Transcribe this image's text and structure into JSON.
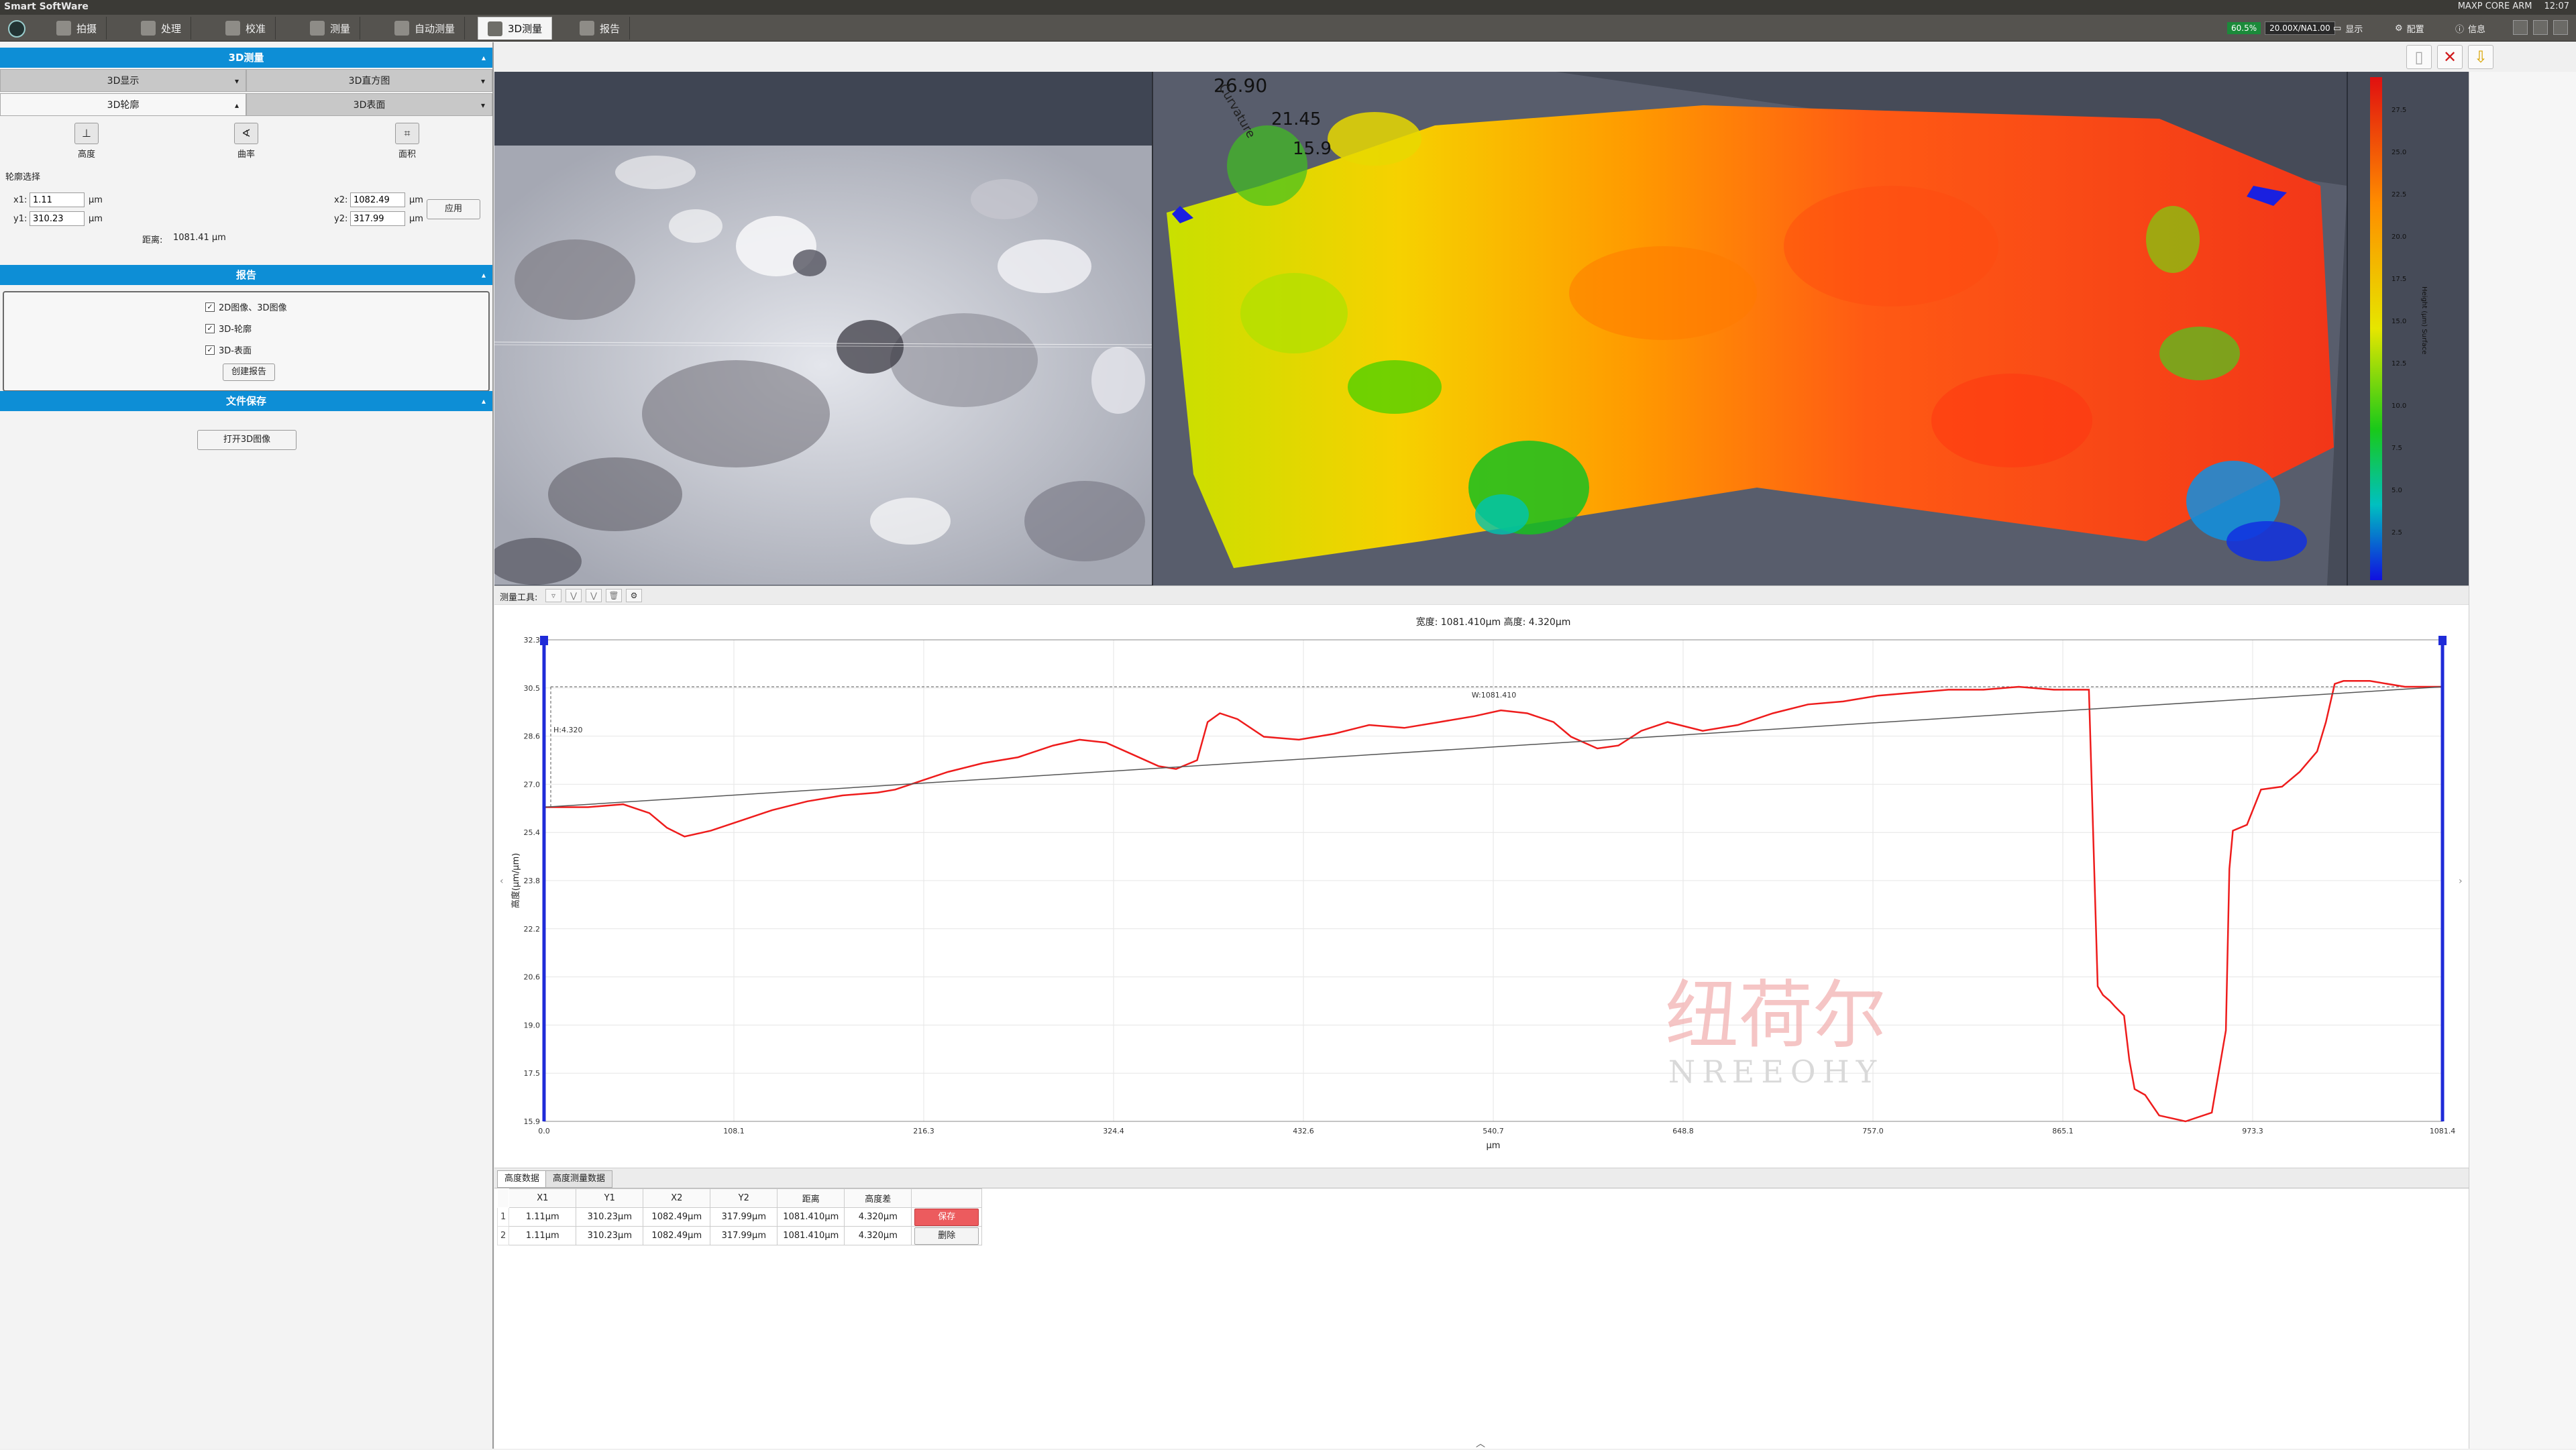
{
  "os_bar": {
    "title": "Smart SoftWare",
    "tray": [
      "MAXP CORE ARM",
      "12:07"
    ]
  },
  "nav_tabs": [
    {
      "label": "拍摄",
      "icon": "camera-icon"
    },
    {
      "label": "处理",
      "icon": "process-icon"
    },
    {
      "label": "校准",
      "icon": "ruler-icon"
    },
    {
      "label": "测量",
      "icon": "measure-icon"
    },
    {
      "label": "自动测量",
      "icon": "auto-measure-icon"
    },
    {
      "label": "3D测量",
      "icon": "cube-icon",
      "active": true
    },
    {
      "label": "报告",
      "icon": "report-icon"
    }
  ],
  "toolbar_right": {
    "status": "60.5%",
    "zoom": "20.00X/NA1.00",
    "display_label": "显示",
    "config_label": "配置",
    "info_label": "信息"
  },
  "left_panel": {
    "measure3d_title": "3D测量",
    "sub_tabs": [
      "3D显示",
      "3D直方图",
      "3D轮廓",
      "3D表面"
    ],
    "tools": [
      {
        "label": "高度",
        "icon": "height-icon",
        "glyph": "⊥"
      },
      {
        "label": "曲率",
        "icon": "curvature-icon",
        "glyph": "∢"
      },
      {
        "label": "面积",
        "icon": "area-icon",
        "glyph": "⌗"
      }
    ],
    "profile_select_label": "轮廓选择",
    "x1_label": "x1:",
    "x1_value": "1.11",
    "y1_label": "y1:",
    "y1_value": "310.23",
    "x2_label": "x2:",
    "x2_value": "1082.49",
    "y2_label": "y2:",
    "y2_value": "317.99",
    "unit": "μm",
    "apply_button": "应用",
    "distance_label": "距离:",
    "distance_value": "1081.41  μm",
    "report_title": "报告",
    "report_options": [
      "2D图像、3D图像",
      "3D-轮廓",
      "3D-表面"
    ],
    "create_report_button": "创建报告",
    "file_save_title": "文件保存",
    "open_3d_button": "打开3D图像"
  },
  "viewer3d": {
    "axis_values": [
      "26.90",
      "21.45",
      "15.9"
    ],
    "axis_name": "Curvature",
    "colorbar_ticks": [
      "27.5",
      "25.0",
      "22.5",
      "20.0",
      "17.5",
      "15.0",
      "12.5",
      "10.0",
      "7.5",
      "5.0",
      "2.5"
    ],
    "colorbar_label": "Height (μm) Surface"
  },
  "meas_toolbar_label": "测量工具:",
  "chart_data": {
    "type": "line",
    "title": "宽度: 1081.410μm 高度: 4.320μm",
    "xlabel": "μm",
    "ylabel": "高度(μm/μm)",
    "xlim": [
      0.0,
      1081.4
    ],
    "ylim": [
      15.9,
      32.3
    ],
    "x_ticks": [
      "0.0",
      "108.1",
      "216.3",
      "324.4",
      "432.6",
      "540.7",
      "648.8",
      "757.0",
      "865.1",
      "973.3",
      "1081.4"
    ],
    "y_ticks": [
      "32.3",
      "30.5",
      "28.6",
      "27.0",
      "25.4",
      "23.8",
      "22.2",
      "20.6",
      "19.0",
      "17.5",
      "15.9"
    ],
    "annotation_width": "W:1081.410",
    "annotation_height": "H:4.320",
    "grid": true,
    "watermark_cn": "纽荷尔",
    "watermark_en": "NREEOHY",
    "series": [
      {
        "color": "#ee1c1c",
        "x": [
          0,
          25,
          45,
          60,
          70,
          80,
          95,
          110,
          130,
          150,
          170,
          190,
          200,
          215,
          230,
          250,
          270,
          290,
          305,
          320,
          335,
          350,
          360,
          372,
          378,
          385,
          395,
          410,
          430,
          450,
          470,
          490,
          510,
          530,
          545,
          560,
          575,
          585,
          600,
          612,
          625,
          640,
          660,
          680,
          700,
          720,
          740,
          760,
          780,
          800,
          820,
          840,
          860,
          870,
          880,
          885,
          888,
          892,
          895,
          900,
          903,
          906,
          912,
          920,
          935,
          950,
          958,
          960,
          962,
          970,
          978,
          990,
          1000,
          1010,
          1015,
          1020,
          1025,
          1040,
          1060,
          1081.4
        ],
        "y": [
          26.6,
          26.6,
          26.7,
          26.4,
          25.9,
          25.6,
          25.8,
          26.1,
          26.5,
          26.8,
          27.0,
          27.1,
          27.2,
          27.5,
          27.8,
          28.1,
          28.3,
          28.7,
          28.9,
          28.8,
          28.4,
          28.0,
          27.9,
          28.2,
          29.5,
          29.8,
          29.6,
          29.0,
          28.9,
          29.1,
          29.4,
          29.3,
          29.5,
          29.7,
          29.9,
          29.8,
          29.5,
          29.0,
          28.6,
          28.7,
          29.2,
          29.5,
          29.2,
          29.4,
          29.8,
          30.1,
          30.2,
          30.4,
          30.5,
          30.6,
          30.6,
          30.7,
          30.6,
          30.6,
          30.6,
          20.5,
          20.2,
          20.0,
          19.8,
          19.5,
          18.0,
          17.0,
          16.8,
          16.1,
          15.9,
          16.2,
          19.0,
          24.5,
          25.8,
          26.0,
          27.2,
          27.3,
          27.8,
          28.5,
          29.5,
          30.8,
          30.9,
          30.9,
          30.7,
          30.7
        ]
      },
      {
        "color": "#555555",
        "x": [
          0,
          1081.4
        ],
        "y": [
          26.6,
          30.7
        ]
      }
    ]
  },
  "table": {
    "tabs": [
      "高度数据",
      "高度测量数据"
    ],
    "headers": [
      "X1",
      "Y1",
      "X2",
      "Y2",
      "距离",
      "高度差"
    ],
    "rows": [
      {
        "num": "1",
        "cells": [
          "1.11μm",
          "310.23μm",
          "1082.49μm",
          "317.99μm",
          "1081.410μm",
          "4.320μm"
        ],
        "action": "保存"
      },
      {
        "num": "2",
        "cells": [
          "1.11μm",
          "310.23μm",
          "1082.49μm",
          "317.99μm",
          "1081.410μm",
          "4.320μm"
        ],
        "action": "删除"
      }
    ]
  }
}
